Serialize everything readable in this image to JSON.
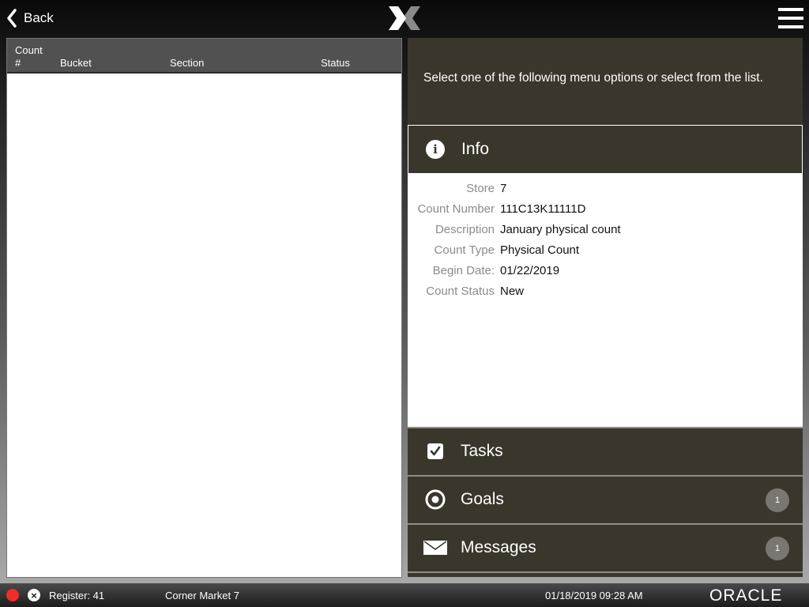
{
  "topbar": {
    "back_label": "Back",
    "logo_icon": "x-logo-icon",
    "menu_icon": "hamburger-menu-icon"
  },
  "list": {
    "columns": [
      {
        "line1": "Count",
        "line2": "#"
      },
      {
        "line1": "",
        "line2": "Bucket"
      },
      {
        "line1": "",
        "line2": "Section"
      },
      {
        "line1": "",
        "line2": "Status"
      }
    ],
    "rows": []
  },
  "right": {
    "prompt": "Select one of the following menu options or select from the list.",
    "info": {
      "title": "Info",
      "icon": "info-icon",
      "fields": [
        {
          "label": "Store",
          "value": "7"
        },
        {
          "label": "Count Number",
          "value": "111C13K11111D"
        },
        {
          "label": "Description",
          "value": "January physical count"
        },
        {
          "label": "Count Type",
          "value": "Physical Count"
        },
        {
          "label": "Begin Date:",
          "value": "01/22/2019"
        },
        {
          "label": "Count Status",
          "value": "New"
        }
      ]
    },
    "menu": [
      {
        "label": "Tasks",
        "icon": "checkbox-icon",
        "badge": null
      },
      {
        "label": "Goals",
        "icon": "target-icon",
        "badge": "1"
      },
      {
        "label": "Messages",
        "icon": "envelope-icon",
        "badge": "1"
      }
    ]
  },
  "statusbar": {
    "register": "Register: 41",
    "store_name": "Corner Market 7",
    "datetime": "01/18/2019 09:28 AM",
    "brand": "ORACLE",
    "status_color": "#f22b2b"
  }
}
